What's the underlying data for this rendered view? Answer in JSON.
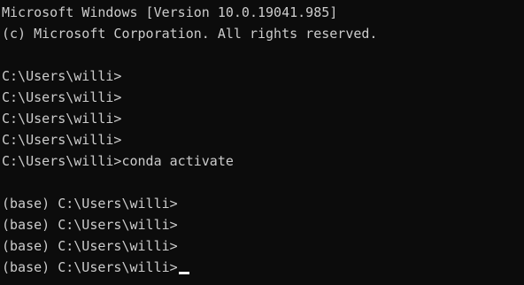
{
  "terminal": {
    "lines": [
      "Microsoft Windows [Version 10.0.19041.985]",
      "(c) Microsoft Corporation. All rights reserved.",
      "",
      "C:\\Users\\willi>",
      "C:\\Users\\willi>",
      "C:\\Users\\willi>",
      "C:\\Users\\willi>",
      "C:\\Users\\willi>conda activate",
      "",
      "(base) C:\\Users\\willi>",
      "(base) C:\\Users\\willi>",
      "(base) C:\\Users\\willi>",
      "(base) C:\\Users\\willi>"
    ],
    "colors": {
      "background": "#0c0c0c",
      "text": "#cccccc",
      "cursor": "#f2f2f2"
    }
  }
}
